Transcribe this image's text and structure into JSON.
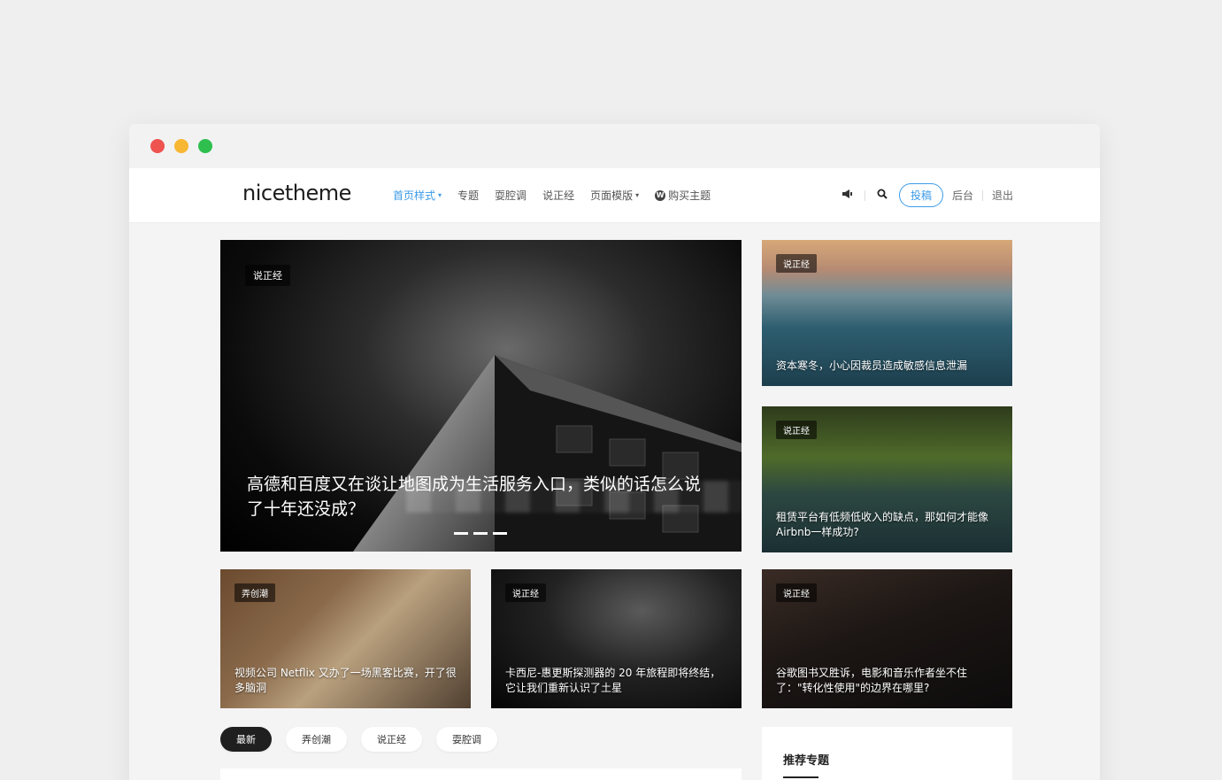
{
  "window": {
    "dots": [
      "close",
      "minimize",
      "maximize"
    ]
  },
  "navbar": {
    "logo": "nicetheme",
    "menu": [
      {
        "label": "首页样式",
        "has_dropdown": true,
        "active": true
      },
      {
        "label": "专题",
        "has_dropdown": false,
        "active": false
      },
      {
        "label": "耍腔调",
        "has_dropdown": false,
        "active": false
      },
      {
        "label": "说正经",
        "has_dropdown": false,
        "active": false
      },
      {
        "label": "页面模版",
        "has_dropdown": true,
        "active": false
      },
      {
        "label": "购买主题",
        "has_dropdown": false,
        "active": false,
        "icon": "wordpress-icon"
      }
    ],
    "tools": {
      "announce_icon": "megaphone-icon",
      "search_icon": "search-icon",
      "post_button": "投稿",
      "admin_link": "后台",
      "logout_link": "退出"
    },
    "accent_color": "#3c9be8"
  },
  "hero": {
    "tag": "说正经",
    "title": "高德和百度又在谈让地图成为生活服务入口，类似的话怎么说了十年还没成？",
    "slides": 3
  },
  "cards": [
    {
      "tag": "说正经",
      "title": "资本寒冬，小心因裁员造成敏感信息泄漏"
    },
    {
      "tag": "说正经",
      "title": "租赁平台有低频低收入的缺点，那如何才能像 Airbnb一样成功?"
    },
    {
      "tag": "弄创潮",
      "title": "视频公司 Netflix 又办了一场黑客比赛，开了很多脑洞"
    },
    {
      "tag": "说正经",
      "title": "卡西尼-惠更斯探测器的 20 年旅程即将终结，它让我们重新认识了土星"
    },
    {
      "tag": "说正经",
      "title": "谷歌图书又胜诉，电影和音乐作者坐不住了：\"转化性使用\"的边界在哪里?"
    }
  ],
  "filters": [
    {
      "label": "最新",
      "active": true
    },
    {
      "label": "弄创潮",
      "active": false
    },
    {
      "label": "说正经",
      "active": false
    },
    {
      "label": "耍腔调",
      "active": false
    }
  ],
  "sidebar": {
    "title": "推荐专题"
  }
}
